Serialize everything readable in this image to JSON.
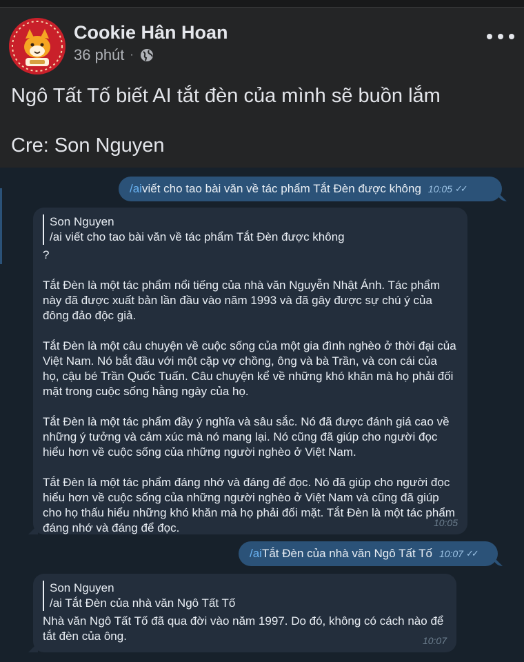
{
  "post": {
    "author": "Cookie Hân Hoan",
    "time": "36 phút",
    "separator": "·",
    "text_lines": [
      "Ngô Tất Tố biết AI tắt đèn của mình sẽ buồn lắm",
      "Cre: Son Nguyen"
    ]
  },
  "chat": {
    "msg1": {
      "command": "/ai",
      "text": " viết cho tao bài văn về tác phẩm Tắt Đèn được không",
      "time": "10:05",
      "ticks": "✓✓"
    },
    "reply1": {
      "quote_name": "Son Nguyen",
      "quote_text": "/ai viết cho tao bài văn về tác phẩm Tắt Đèn được không",
      "paragraphs": [
        "?",
        "Tắt Đèn là một tác phẩm nổi tiếng của nhà văn Nguyễn Nhật Ánh. Tác phẩm này đã được xuất bản lần đầu vào năm 1993 và đã gây được sự chú ý của đông đảo độc giả.",
        "Tắt Đèn là một câu chuyện về cuộc sống của một gia đình nghèo ở thời đại của Việt Nam. Nó bắt đầu với một cặp vợ chồng, ông và bà Trần, và con cái của họ, cậu bé Trần Quốc Tuấn. Câu chuyện kể về những khó khăn mà họ phải đối mặt trong cuộc sống hằng ngày của họ.",
        "Tắt Đèn là một tác phẩm đầy ý nghĩa và sâu sắc. Nó đã được đánh giá cao về những ý tưởng và cảm xúc mà nó mang lại. Nó cũng đã giúp cho người đọc hiểu hơn về cuộc sống của những người nghèo ở Việt Nam.",
        "Tắt Đèn là một tác phẩm đáng nhớ và đáng để đọc. Nó đã giúp cho người đọc hiểu hơn về cuộc sống của những người nghèo ở Việt Nam và cũng đã giúp cho họ thấu hiểu những khó khăn mà họ phải đối mặt. Tắt Đèn là một tác phẩm đáng nhớ và đáng để đọc."
      ],
      "time": "10:05"
    },
    "msg2": {
      "command": "/ai",
      "text": " Tắt Đèn của nhà văn Ngô Tất Tố",
      "time": "10:07",
      "ticks": "✓✓"
    },
    "reply2": {
      "quote_name": "Son Nguyen",
      "quote_text": "/ai Tắt Đèn của nhà văn Ngô Tất Tố",
      "text": "Nhà văn Ngô Tất Tố đã qua đời vào năm 1997. Do đó, không có cách nào để tắt đèn của ông.",
      "time": "10:07"
    }
  }
}
